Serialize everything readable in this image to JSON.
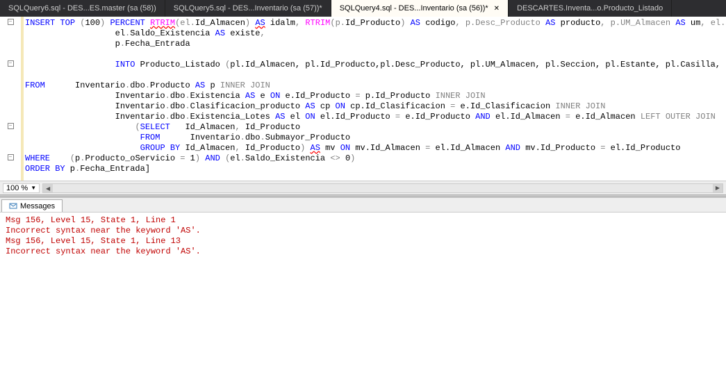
{
  "tabs": [
    {
      "label": "SQLQuery6.sql - DES...ES.master (sa (58))"
    },
    {
      "label": "SQLQuery5.sql - DES...Inventario (sa (57))*"
    },
    {
      "label": "SQLQuery4.sql - DES...Inventario (sa (56))*"
    },
    {
      "label": "DESCARTES.Inventa...o.Producto_Listado"
    }
  ],
  "activeTabIndex": 2,
  "zoom": "100 %",
  "resultsTab": "Messages",
  "code": {
    "l1_insert": "INSERT",
    "l1_top": " TOP",
    "l1_paren1": " (",
    "l1_100": "100",
    "l1_paren2": ") ",
    "l1_percent": "PERCENT",
    "l1_sp1": " ",
    "l1_rtrim1": "RTRIM",
    "l1_arg1": "(el",
    "l1_dot1": ".",
    "l1_idalm": "Id_Almacen",
    "l1_paren3": ")",
    "l1_sp2": " ",
    "l1_as1": "AS",
    "l1_idalm2": " idalm",
    "l1_comma1": ",",
    "l1_sp3": " ",
    "l1_rtrim2": "RTRIM",
    "l1_arg2": "(p",
    "l1_dot2": ".",
    "l1_idprod": "Id_Producto",
    "l1_paren4": ")",
    "l1_sp4": " ",
    "l1_as2": "AS",
    "l1_cod": " codigo",
    "l1_rest": ", p.Desc_Producto ",
    "l1_as3": "AS",
    "l1_prod": " producto",
    "l1_rest2": ", p.UM_Almacen ",
    "l1_as4": "AS",
    "l1_um": " um",
    "l1_rest3": ", el.S",
    "l2_pre": "                  el",
    "l2_dot": ".",
    "l2_saldo": "Saldo_Existencia ",
    "l2_as": "AS",
    "l2_existe": " existe",
    "l2_comma": ",",
    "l3_pre": "                  p",
    "l3_dot": ".",
    "l3_fecha": "Fecha_Entrada",
    "l5_pre": "                  ",
    "l5_into": "INTO",
    "l5_pl": " Producto_Listado ",
    "l5_open": "(",
    "l5_rest": "pl.Id_Almacen, pl.Id_Producto,pl.Desc_Producto, pl.UM_Almacen, pl.Seccion, pl.Estante, pl.Casilla, pl.Sa",
    "l7_from": "FROM",
    "l7_pre": "      Inventario",
    "l7_dot": ".",
    "l7_dbo": "dbo",
    "l7_dot2": ".",
    "l7_prod": "Producto ",
    "l7_as": "AS",
    "l7_p": " p ",
    "l7_inner": "INNER JOIN",
    "l8_pre": "                  Inventario",
    "l8_dot": ".",
    "l8_dbo": "dbo",
    "l8_dot2": ".",
    "l8_ex": "Existencia ",
    "l8_as": "AS",
    "l8_e": " e ",
    "l8_on": "ON",
    "l8_cond": " e.Id_Producto ",
    "l8_eq": "=",
    "l8_cond2": " p.Id_Producto ",
    "l8_inner": "INNER JOIN",
    "l9_pre": "                  Inventario",
    "l9_dot": ".",
    "l9_dbo": "dbo",
    "l9_dot2": ".",
    "l9_clas": "Clasificacion_producto ",
    "l9_as": "AS",
    "l9_cp": " cp ",
    "l9_on": "ON",
    "l9_cond": " cp.Id_Clasificacion ",
    "l9_eq": "=",
    "l9_cond2": " e.Id_Clasificacion ",
    "l9_inner": "INNER JOIN",
    "l10_pre": "                  Inventario",
    "l10_dot": ".",
    "l10_dbo": "dbo",
    "l10_dot2": ".",
    "l10_el": "Existencia_Lotes ",
    "l10_as": "AS",
    "l10_el2": " el ",
    "l10_on": "ON",
    "l10_cond": " el.Id_Producto ",
    "l10_eq": "=",
    "l10_cond2": " e.Id_Producto ",
    "l10_and": "AND",
    "l10_cond3": " el.Id_Almacen ",
    "l10_eq2": "=",
    "l10_cond4": " e.Id_Almacen ",
    "l10_left": "LEFT OUTER JOIN",
    "l11_pre": "                      ",
    "l11_open": "(",
    "l11_select": "SELECT",
    "l11_cols": "   Id_Almacen",
    "l11_comma": ",",
    "l11_col2": " Id_Producto",
    "l12_pre": "                       ",
    "l12_from": "FROM",
    "l12_tbl": "      Inventario",
    "l12_dot": ".",
    "l12_dbo": "dbo",
    "l12_dot2": ".",
    "l12_sub": "Submayor_Producto",
    "l13_pre": "                       ",
    "l13_group": "GROUP BY",
    "l13_cols": " Id_Almacen",
    "l13_comma": ",",
    "l13_col2": " Id_Producto",
    "l13_close": ")",
    "l13_sp": " ",
    "l13_as": "AS",
    "l13_mv": " mv ",
    "l13_on": "ON",
    "l13_cond": " mv.Id_Almacen ",
    "l13_eq": "=",
    "l13_cond2": " el.Id_Almacen ",
    "l13_and": "AND",
    "l13_cond3": " mv.Id_Producto ",
    "l13_eq2": "=",
    "l13_cond4": " el.Id_Producto",
    "l14_where": "WHERE",
    "l14_pre": "    ",
    "l14_open": "(",
    "l14_p": "p",
    "l14_dot": ".",
    "l14_pos": "Producto_oServicio ",
    "l14_eq": "=",
    "l14_sp": " ",
    "l14_1": "1",
    "l14_close": ")",
    "l14_sp2": " ",
    "l14_and": "AND",
    "l14_sp3": " ",
    "l14_open2": "(",
    "l14_el": "el",
    "l14_dot2": ".",
    "l14_saldo": "Saldo_Existencia ",
    "l14_ne": "<>",
    "l14_sp4": " ",
    "l14_0": "0",
    "l14_close2": ")",
    "l15_order": "ORDER BY",
    "l15_p": " p",
    "l15_dot": ".",
    "l15_fecha": "Fecha_Entrada]",
    "cursor": "|"
  },
  "messages": [
    "Msg 156, Level 15, State 1, Line 1",
    "Incorrect syntax near the keyword 'AS'.",
    "Msg 156, Level 15, State 1, Line 13",
    "Incorrect syntax near the keyword 'AS'."
  ]
}
